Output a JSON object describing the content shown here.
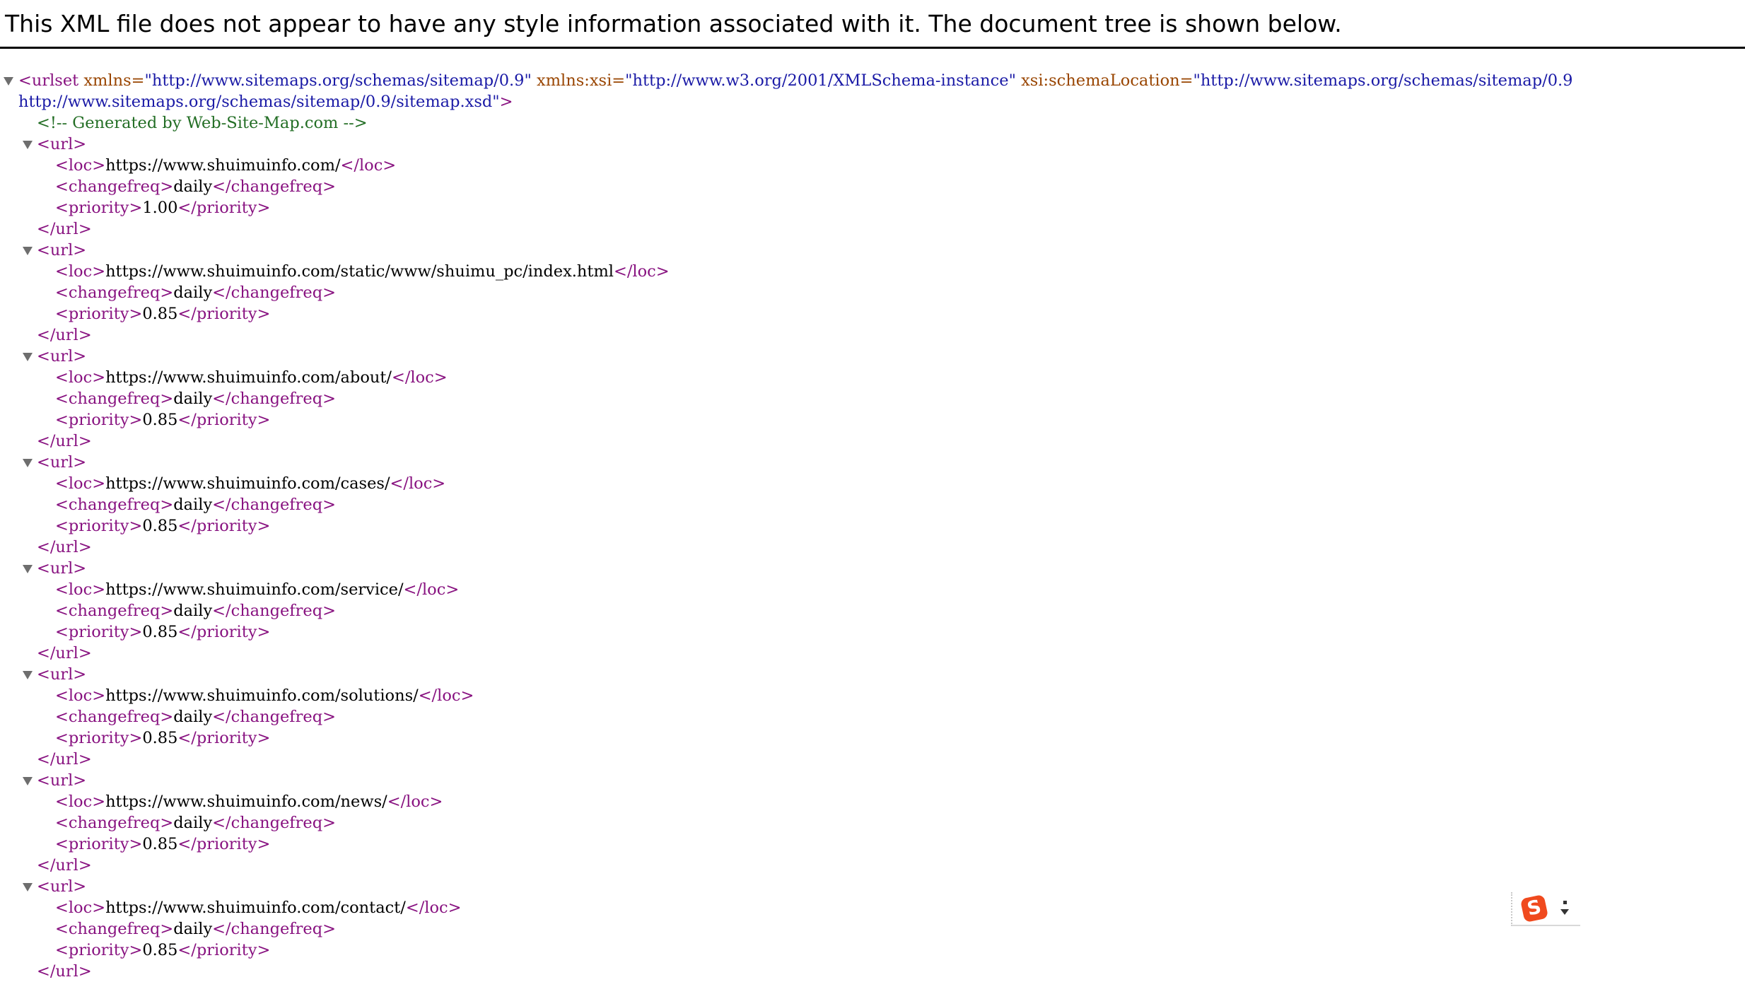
{
  "header": {
    "message": "This XML file does not appear to have any style information associated with it. The document tree is shown below."
  },
  "tree": {
    "root_open_1": "<urlset",
    "root_attr_xmlns_name": "xmlns=",
    "root_attr_xmlns_val": "\"http://www.sitemaps.org/schemas/sitemap/0.9\"",
    "root_attr_xsi_name": "xmlns:xsi=",
    "root_attr_xsi_val": "\"http://www.w3.org/2001/XMLSchema-instance\"",
    "root_attr_schema_name": "xsi:schemaLocation=",
    "root_attr_schema_val_1": "\"http://www.sitemaps.org/schemas/sitemap/0.9",
    "root_attr_schema_val_2": "http://www.sitemaps.org/schemas/sitemap/0.9/sitemap.xsd\"",
    "root_close_bracket": ">",
    "comment": "<!--  Generated by Web-Site-Map.com  -->",
    "url_open": "<url>",
    "url_close": "</url>",
    "loc_open": "<loc>",
    "loc_close": "</loc>",
    "changefreq_open": "<changefreq>",
    "changefreq_close": "</changefreq>",
    "priority_open": "<priority>",
    "priority_close": "</priority>",
    "urls": [
      {
        "loc": "https://www.shuimuinfo.com/",
        "changefreq": "daily",
        "priority": "1.00"
      },
      {
        "loc": "https://www.shuimuinfo.com/static/www/shuimu_pc/index.html",
        "changefreq": "daily",
        "priority": "0.85"
      },
      {
        "loc": "https://www.shuimuinfo.com/about/",
        "changefreq": "daily",
        "priority": "0.85"
      },
      {
        "loc": "https://www.shuimuinfo.com/cases/",
        "changefreq": "daily",
        "priority": "0.85"
      },
      {
        "loc": "https://www.shuimuinfo.com/service/",
        "changefreq": "daily",
        "priority": "0.85"
      },
      {
        "loc": "https://www.shuimuinfo.com/solutions/",
        "changefreq": "daily",
        "priority": "0.85"
      },
      {
        "loc": "https://www.shuimuinfo.com/news/",
        "changefreq": "daily",
        "priority": "0.85"
      },
      {
        "loc": "https://www.shuimuinfo.com/contact/",
        "changefreq": "daily",
        "priority": "0.85"
      }
    ]
  },
  "ime": {
    "logo": "S",
    "icon": "sogou-ime-icon"
  }
}
